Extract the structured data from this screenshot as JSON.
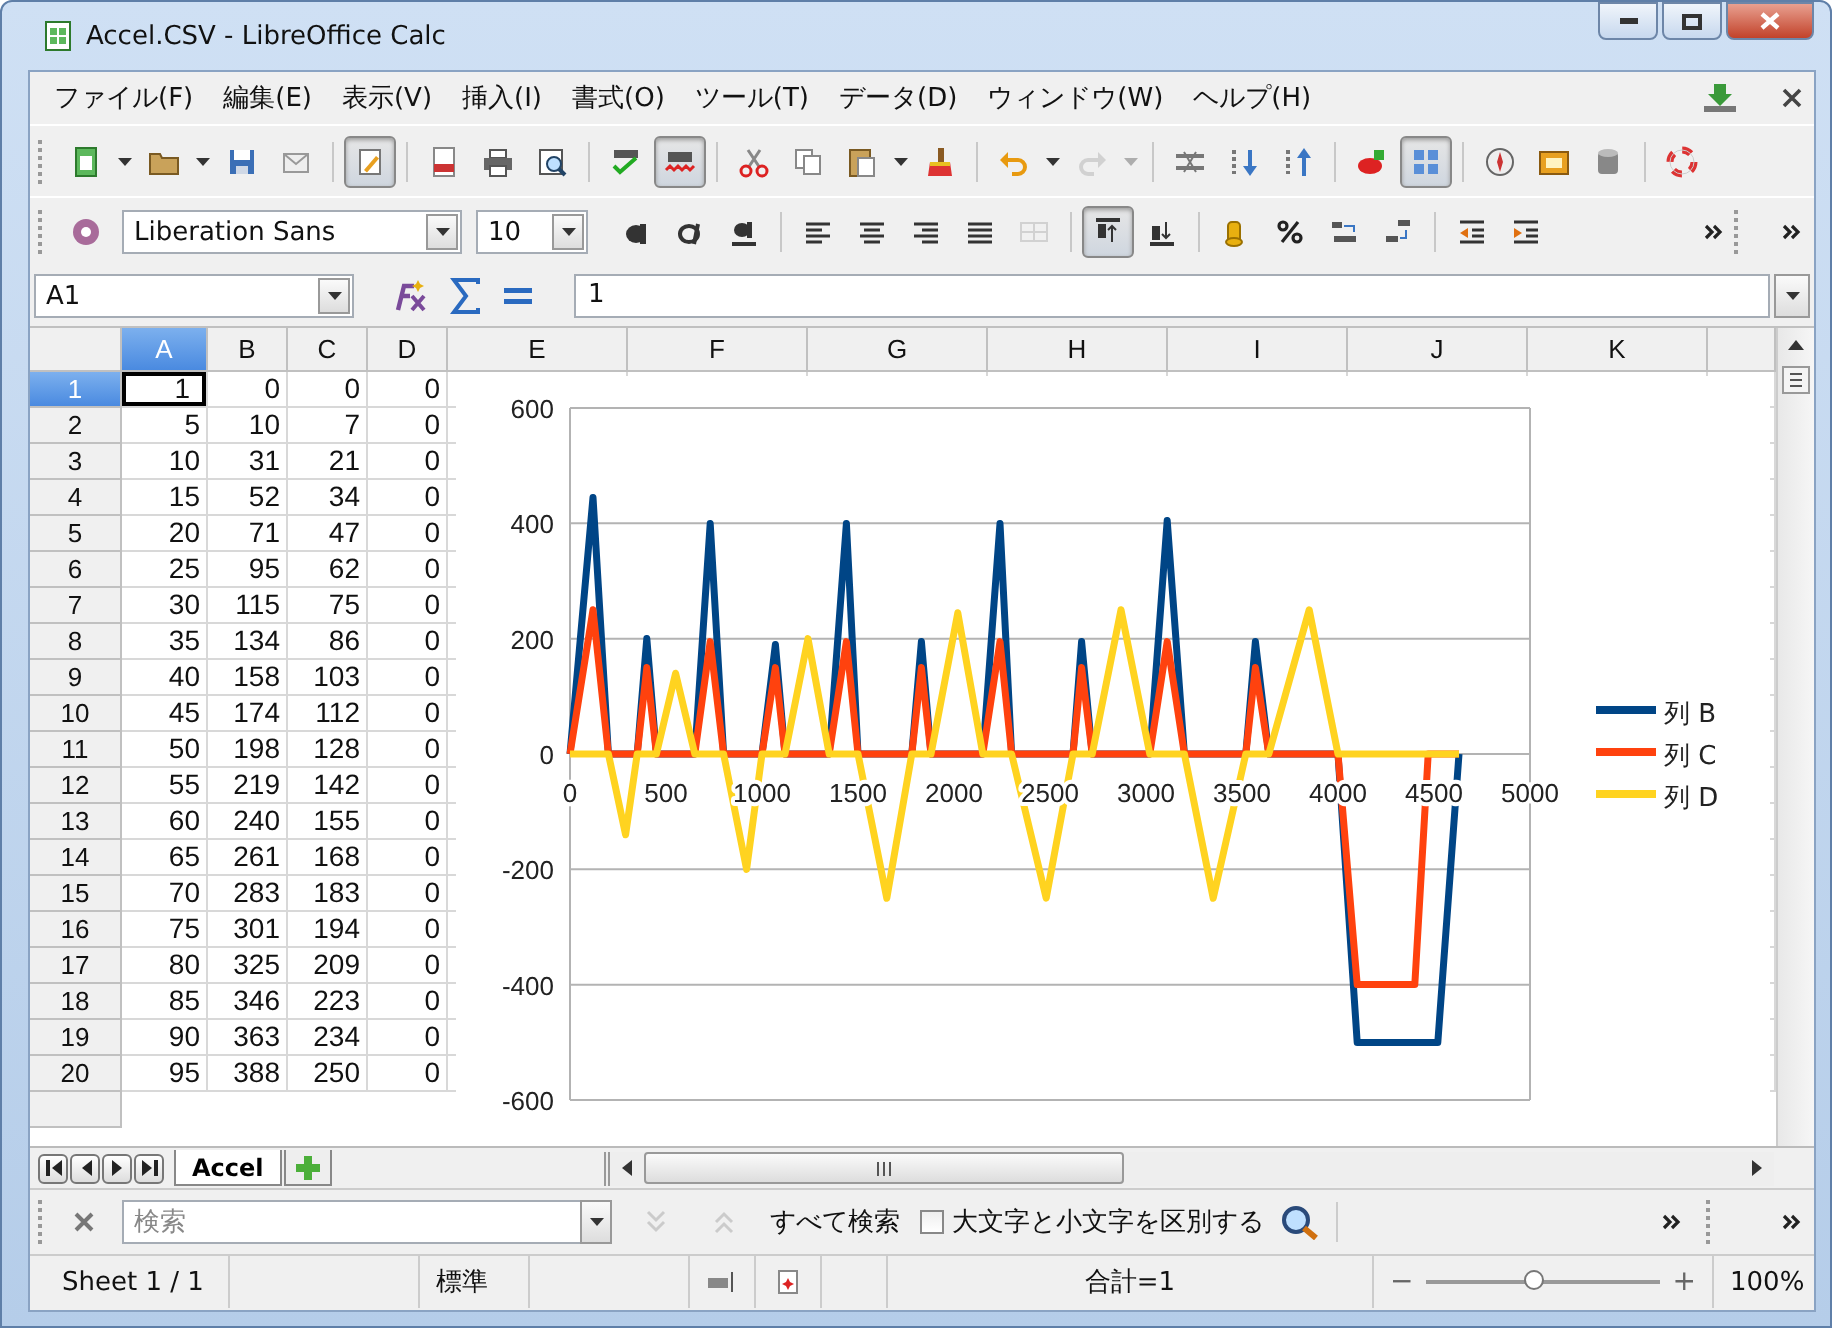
{
  "window": {
    "title": "Accel.CSV - LibreOffice Calc"
  },
  "menu": [
    {
      "label": "ファイル(F)"
    },
    {
      "label": "編集(E)"
    },
    {
      "label": "表示(V)"
    },
    {
      "label": "挿入(I)"
    },
    {
      "label": "書式(O)"
    },
    {
      "label": "ツール(T)"
    },
    {
      "label": "データ(D)"
    },
    {
      "label": "ウィンドウ(W)"
    },
    {
      "label": "ヘルプ(H)"
    }
  ],
  "standard_toolbar": {
    "edit_file": {
      "pressed": true
    },
    "auto_spellcheck": {
      "pressed": true
    },
    "redo": {
      "disabled": true
    },
    "show_draw_functions": {
      "pressed": true
    }
  },
  "formatting_toolbar": {
    "font_name": "Liberation Sans",
    "font_size": "10",
    "merge_cells": {
      "disabled": true
    },
    "align_top": {
      "pressed": true
    }
  },
  "formula_bar": {
    "name_box": "A1",
    "content": "1"
  },
  "columns": [
    {
      "label": "A",
      "selected": true
    },
    {
      "label": "B",
      "selected": false
    },
    {
      "label": "C",
      "selected": false
    },
    {
      "label": "D",
      "selected": false
    },
    {
      "label": "E",
      "selected": false
    },
    {
      "label": "F",
      "selected": false
    },
    {
      "label": "G",
      "selected": false
    },
    {
      "label": "H",
      "selected": false
    },
    {
      "label": "I",
      "selected": false
    },
    {
      "label": "J",
      "selected": false
    },
    {
      "label": "K",
      "selected": false
    }
  ],
  "rows": [
    {
      "header": "1",
      "selected": true,
      "cells": [
        "1",
        "0",
        "0",
        "0"
      ]
    },
    {
      "header": "2",
      "selected": false,
      "cells": [
        "5",
        "10",
        "7",
        "0"
      ]
    },
    {
      "header": "3",
      "selected": false,
      "cells": [
        "10",
        "31",
        "21",
        "0"
      ]
    },
    {
      "header": "4",
      "selected": false,
      "cells": [
        "15",
        "52",
        "34",
        "0"
      ]
    },
    {
      "header": "5",
      "selected": false,
      "cells": [
        "20",
        "71",
        "47",
        "0"
      ]
    },
    {
      "header": "6",
      "selected": false,
      "cells": [
        "25",
        "95",
        "62",
        "0"
      ]
    },
    {
      "header": "7",
      "selected": false,
      "cells": [
        "30",
        "115",
        "75",
        "0"
      ]
    },
    {
      "header": "8",
      "selected": false,
      "cells": [
        "35",
        "134",
        "86",
        "0"
      ]
    },
    {
      "header": "9",
      "selected": false,
      "cells": [
        "40",
        "158",
        "103",
        "0"
      ]
    },
    {
      "header": "10",
      "selected": false,
      "cells": [
        "45",
        "174",
        "112",
        "0"
      ]
    },
    {
      "header": "11",
      "selected": false,
      "cells": [
        "50",
        "198",
        "128",
        "0"
      ]
    },
    {
      "header": "12",
      "selected": false,
      "cells": [
        "55",
        "219",
        "142",
        "0"
      ]
    },
    {
      "header": "13",
      "selected": false,
      "cells": [
        "60",
        "240",
        "155",
        "0"
      ]
    },
    {
      "header": "14",
      "selected": false,
      "cells": [
        "65",
        "261",
        "168",
        "0"
      ]
    },
    {
      "header": "15",
      "selected": false,
      "cells": [
        "70",
        "283",
        "183",
        "0"
      ]
    },
    {
      "header": "16",
      "selected": false,
      "cells": [
        "75",
        "301",
        "194",
        "0"
      ]
    },
    {
      "header": "17",
      "selected": false,
      "cells": [
        "80",
        "325",
        "209",
        "0"
      ]
    },
    {
      "header": "18",
      "selected": false,
      "cells": [
        "85",
        "346",
        "223",
        "0"
      ]
    },
    {
      "header": "19",
      "selected": false,
      "cells": [
        "90",
        "363",
        "234",
        "0"
      ]
    },
    {
      "header": "20",
      "selected": false,
      "cells": [
        "95",
        "388",
        "250",
        "0"
      ]
    }
  ],
  "chart": {
    "chart_data": {
      "type": "line",
      "grid": true,
      "legend": true,
      "x": [
        0,
        120,
        200,
        290,
        350,
        400,
        450,
        550,
        650,
        730,
        800,
        920,
        1000,
        1070,
        1120,
        1240,
        1350,
        1440,
        1500,
        1650,
        1780,
        1830,
        1880,
        2020,
        2150,
        2240,
        2300,
        2480,
        2620,
        2665,
        2720,
        2870,
        3020,
        3110,
        3200,
        3350,
        3520,
        3570,
        3640,
        3850,
        4000,
        4100,
        4400,
        4470,
        4520,
        4630
      ],
      "series": [
        {
          "name": "列 B",
          "color": "#004586",
          "values": [
            0,
            445,
            0,
            0,
            0,
            200,
            0,
            0,
            0,
            400,
            0,
            0,
            0,
            190,
            0,
            0,
            0,
            400,
            0,
            0,
            0,
            195,
            0,
            0,
            0,
            400,
            0,
            0,
            0,
            195,
            0,
            0,
            0,
            405,
            0,
            0,
            0,
            195,
            0,
            0,
            0,
            -500,
            -500,
            -500,
            -500,
            0
          ]
        },
        {
          "name": "列 C",
          "color": "#ff420e",
          "values": [
            0,
            250,
            0,
            0,
            0,
            150,
            0,
            0,
            0,
            195,
            0,
            0,
            0,
            150,
            0,
            0,
            0,
            195,
            0,
            0,
            0,
            150,
            0,
            0,
            0,
            195,
            0,
            0,
            0,
            150,
            0,
            0,
            0,
            195,
            0,
            0,
            0,
            150,
            0,
            0,
            0,
            -400,
            -400,
            0,
            0,
            0
          ]
        },
        {
          "name": "列 D",
          "color": "#ffd320",
          "values": [
            0,
            0,
            0,
            -140,
            0,
            0,
            0,
            140,
            0,
            0,
            0,
            -200,
            0,
            0,
            0,
            200,
            0,
            0,
            0,
            -250,
            0,
            0,
            0,
            245,
            0,
            0,
            0,
            -250,
            0,
            0,
            0,
            250,
            0,
            0,
            0,
            -250,
            0,
            0,
            0,
            250,
            0,
            0,
            0,
            0,
            0,
            0
          ]
        }
      ],
      "xlim": [
        0,
        5000
      ],
      "ylim": [
        -600,
        600
      ],
      "xticks": [
        0,
        500,
        1000,
        1500,
        2000,
        2500,
        3000,
        3500,
        4000,
        4500,
        5000
      ],
      "yticks": [
        -600,
        -400,
        -200,
        0,
        200,
        400,
        600
      ]
    }
  },
  "sheet_tabs": [
    {
      "label": "Accel",
      "selected": true
    }
  ],
  "find_toolbar": {
    "search": {
      "placeholder": "検索"
    },
    "find_next": {
      "disabled": true
    },
    "find_previous": {
      "disabled": true
    },
    "find_all": "すべて検索",
    "match_case": {
      "label": "大文字と小文字を区別する",
      "checked": false
    }
  },
  "status_bar": {
    "sheet": "Sheet 1 / 1",
    "page_style": "標準",
    "sum": "合計=1",
    "zoom_out": "−",
    "zoom_in": "+",
    "zoom": {
      "level": 0.46,
      "reading": "100%"
    }
  }
}
